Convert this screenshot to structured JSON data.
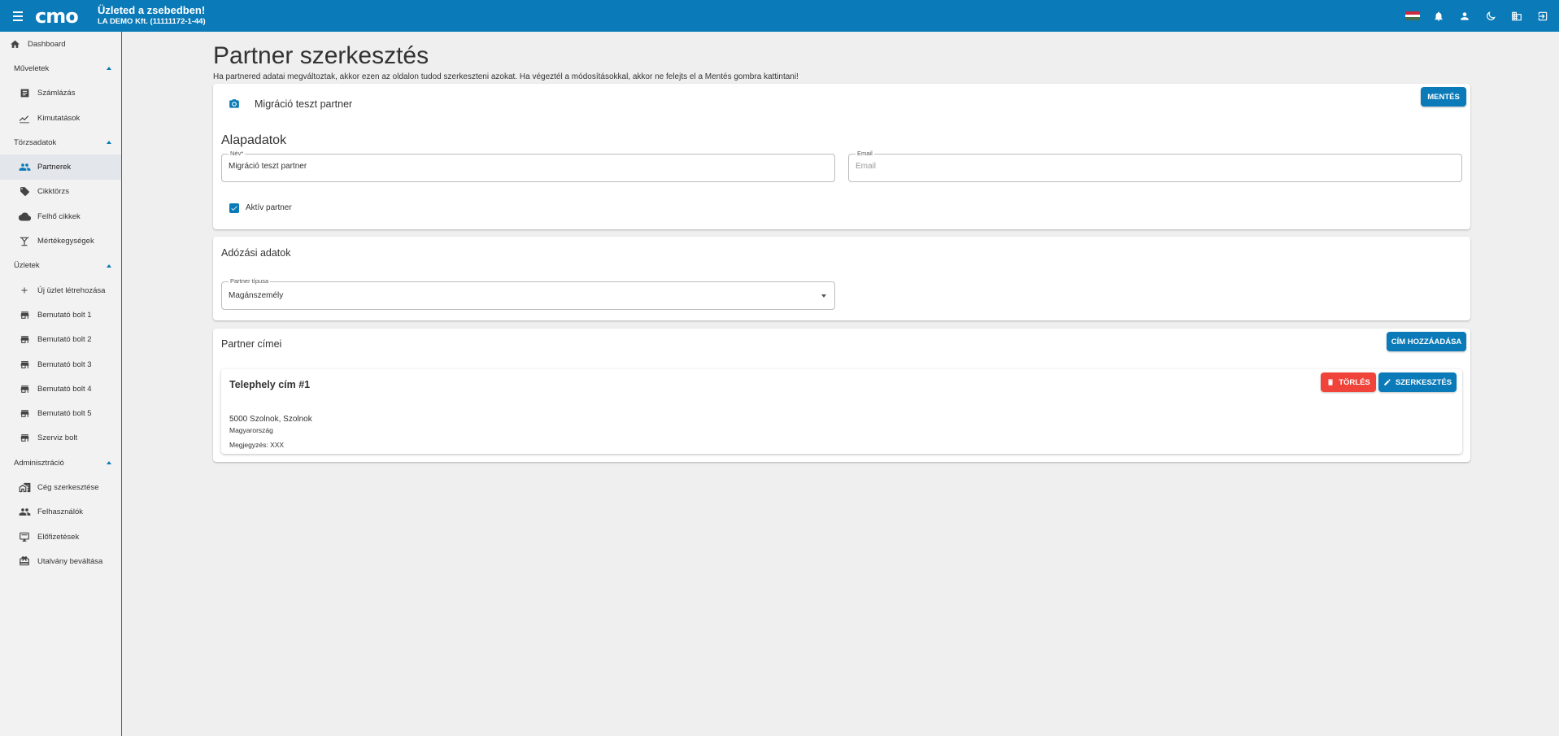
{
  "app": {
    "name": "Üzleted a zsebedben!",
    "company": "LA DEMO Kft. (11111172-1-44)",
    "logo_text": "cmo"
  },
  "topbar": {
    "icons": [
      "hungarian-flag",
      "bell-icon",
      "person-icon",
      "moon-icon",
      "company-icon",
      "logout-icon"
    ]
  },
  "sidebar": {
    "dashboard": "Dashboard",
    "sections": [
      {
        "title": "Műveletek",
        "items": [
          "Számlázás",
          "Kimutatások"
        ]
      },
      {
        "title": "Törzsadatok",
        "items": [
          "Partnerek",
          "Cikktörzs",
          "Felhő cikkek",
          "Mértékegységek"
        ]
      },
      {
        "title": "Üzletek",
        "items": [
          "Új üzlet létrehozása",
          "Bemutató bolt 1",
          "Bemutató bolt 2",
          "Bemutató bolt 3",
          "Bemutató bolt 4",
          "Bemutató bolt 5",
          "Szerviz bolt"
        ]
      },
      {
        "title": "Adminisztráció",
        "items": [
          "Cég szerkesztése",
          "Felhasználók",
          "Előfizetések",
          "Utalvány beváltása"
        ]
      }
    ],
    "active_item": "Partnerek"
  },
  "page": {
    "title": "Partner szerkesztés",
    "subtitle": "Ha partnered adatai megváltoztak, akkor ezen az oldalon tudod szerkeszteni azokat. Ha végeztél a módosításokkal, akkor ne felejts el a Mentés gombra kattintani!"
  },
  "basic": {
    "partner_name": "Migráció teszt partner",
    "save_label": "MENTÉS",
    "section_title": "Alapadatok",
    "name_label": "Név*",
    "name_value": "Migráció teszt partner",
    "email_label": "Email",
    "email_placeholder": "Email",
    "email_value": "",
    "active_label": "Aktív partner",
    "active_checked": true
  },
  "tax": {
    "section_title": "Adózási adatok",
    "type_label": "Partner típusa",
    "type_value": "Magánszemély"
  },
  "addresses": {
    "section_title": "Partner címei",
    "add_label": "CÍM HOZZÁADÁSA",
    "items": [
      {
        "title": "Telephely cím #1",
        "line1": "5000 Szolnok, Szolnok",
        "line2": "Magyarország",
        "note": "Megjegyzés: XXX",
        "delete_label": "TÖRLÉS",
        "edit_label": "SZERKESZTÉS"
      }
    ]
  },
  "colors": {
    "primary": "#0a7ab8",
    "danger": "#f0443a",
    "background": "#efefef"
  }
}
